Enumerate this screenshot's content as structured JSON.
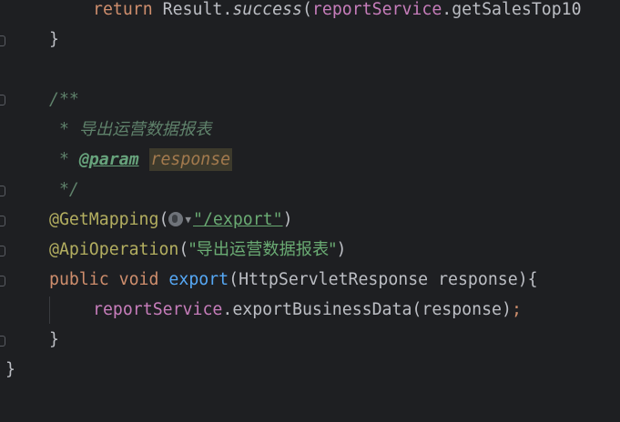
{
  "editor": {
    "line1": {
      "indent": "    ",
      "keyword": "return",
      "class_name": "Result",
      "method": "success",
      "field": "reportService",
      "call": "getSalesTop10"
    },
    "line2": {
      "text": "}"
    },
    "line4": {
      "text": "/**"
    },
    "line5": {
      "star": " * ",
      "text": "导出运营数据报表"
    },
    "line6": {
      "star": " * ",
      "tag": "@param",
      "param": "response"
    },
    "line7": {
      "text": " */"
    },
    "line8": {
      "annotation": "@GetMapping",
      "path": "\"/export\""
    },
    "line9": {
      "annotation": "@ApiOperation",
      "value": "\"导出运营数据报表\""
    },
    "line10": {
      "modifier": "public",
      "return_type": "void",
      "method": "export",
      "param_type": "HttpServletResponse",
      "param_name": "response"
    },
    "line11": {
      "field": "reportService",
      "method": "exportBusinessData",
      "arg": "response"
    },
    "line12": {
      "text": "}"
    },
    "line13": {
      "text": "}"
    }
  },
  "colors": {
    "background": "#1e1f22",
    "keyword": "#cf8e6d",
    "annotation": "#b3ae60",
    "string": "#6aab73",
    "field": "#c77dbb",
    "function_declaration": "#56a8f5",
    "doc_comment": "#5f826b",
    "text": "#bcbec4"
  },
  "icons": {
    "url_marker": "globe-icon",
    "dropdown": "chevron-down-icon"
  }
}
